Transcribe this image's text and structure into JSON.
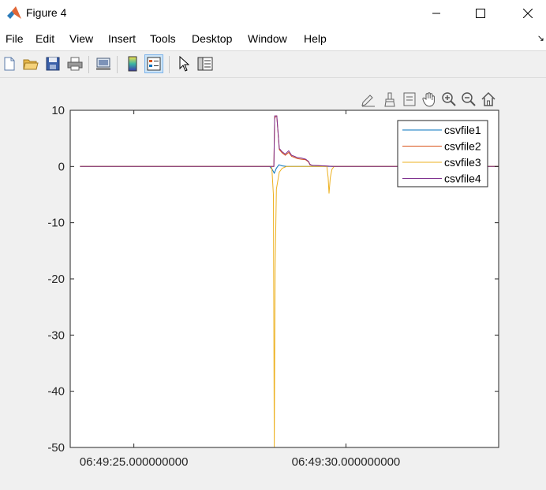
{
  "window": {
    "title": "Figure 4",
    "controls": [
      "minimize-icon",
      "maximize-icon",
      "close-icon"
    ]
  },
  "menu": {
    "items": [
      "File",
      "Edit",
      "View",
      "Insert",
      "Tools",
      "Desktop",
      "Window",
      "Help"
    ],
    "dock_glyph": "↘"
  },
  "toolbar": {
    "buttons": [
      "new-figure-icon",
      "open-file-icon",
      "save-icon",
      "print-icon",
      "link-plot-icon",
      "insert-colorbar-icon",
      "insert-legend-icon",
      "edit-plot-arrow-icon",
      "property-inspector-icon"
    ],
    "active": "insert-legend-icon"
  },
  "axes_toolbar": {
    "buttons": [
      "edit-brush-icon",
      "data-brush-icon",
      "data-tips-icon",
      "pan-hand-icon",
      "zoom-in-icon",
      "zoom-out-icon",
      "home-icon"
    ]
  },
  "chart_data": {
    "type": "line",
    "title": "",
    "xlabel": "",
    "ylabel": "",
    "ylim": [
      -50,
      10
    ],
    "yticks": [
      10,
      0,
      -10,
      -20,
      -30,
      -40,
      -50
    ],
    "xlim_seconds": [
      23.5,
      33.6
    ],
    "xticks": [
      {
        "value": 25,
        "label": "06:49:25.000000000"
      },
      {
        "value": 30,
        "label": "06:49:30.000000000"
      }
    ],
    "legend_position": "top-right",
    "grid": false,
    "series": [
      {
        "name": "csvfile1",
        "color": "#0072bd",
        "x": [
          23.73,
          28.2,
          28.26,
          28.31,
          28.36,
          28.42,
          28.5,
          28.6,
          30.0,
          33.6
        ],
        "y": [
          0,
          0,
          -0.5,
          -1.2,
          -0.3,
          0.3,
          0.1,
          0,
          0,
          0
        ]
      },
      {
        "name": "csvfile2",
        "color": "#d95319",
        "x": [
          23.73,
          28.3,
          28.32,
          28.35,
          28.37,
          28.43,
          28.5,
          28.57,
          28.65,
          28.72,
          28.79,
          28.85,
          28.95,
          29.05,
          29.12,
          29.15,
          29.2,
          29.5,
          29.7,
          33.6
        ],
        "y": [
          0,
          0,
          8.5,
          9.0,
          9.0,
          3.0,
          2.4,
          2.0,
          2.5,
          1.8,
          1.6,
          1.4,
          1.3,
          1.2,
          0.8,
          0.3,
          0.2,
          0.1,
          0,
          0
        ]
      },
      {
        "name": "csvfile3",
        "color": "#edb120",
        "x": [
          23.73,
          28.25,
          28.29,
          28.31,
          28.33,
          28.36,
          28.43,
          28.5,
          28.6,
          29.0,
          29.55,
          29.58,
          29.6,
          29.63,
          29.67,
          29.72,
          33.6
        ],
        "y": [
          0,
          0,
          -5,
          -50,
          -18,
          -4,
          -1,
          -0.3,
          0,
          0,
          0,
          -2,
          -4.8,
          -2,
          -0.5,
          0,
          0
        ]
      },
      {
        "name": "csvfile4",
        "color": "#7e2f8e",
        "x": [
          23.73,
          28.3,
          28.32,
          28.35,
          28.37,
          28.43,
          28.5,
          28.57,
          28.65,
          28.72,
          28.79,
          28.85,
          28.95,
          29.05,
          29.12,
          29.15,
          29.2,
          29.5,
          29.7,
          33.6
        ],
        "y": [
          0,
          0,
          9.0,
          9.0,
          9.0,
          3.2,
          2.6,
          2.2,
          2.8,
          2.0,
          1.8,
          1.6,
          1.5,
          1.3,
          0.9,
          0.4,
          0.2,
          0.1,
          0,
          0
        ]
      }
    ]
  }
}
